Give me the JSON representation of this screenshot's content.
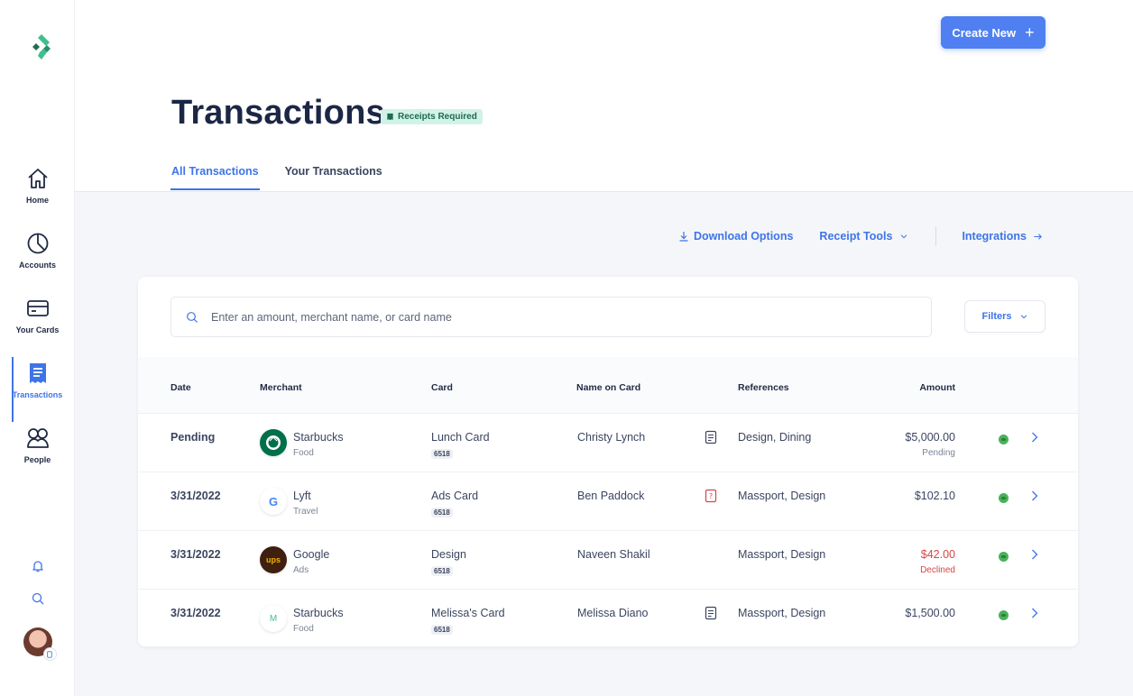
{
  "colors": {
    "accent": "#3f74e8",
    "primary_button": "#4f7ff0",
    "badge_bg": "#d3f2e7",
    "declined": "#d64545",
    "status_ok": "#49b25a"
  },
  "sidebar": {
    "logo": "brand-logo",
    "items": [
      {
        "label": "Home",
        "icon": "home-icon",
        "active": false
      },
      {
        "label": "Accounts",
        "icon": "pie-chart-icon",
        "active": false
      },
      {
        "label": "Your Cards",
        "icon": "credit-card-icon",
        "active": false
      },
      {
        "label": "Transactions",
        "icon": "receipt-icon",
        "active": true
      },
      {
        "label": "People",
        "icon": "people-icon",
        "active": false
      }
    ],
    "bottom": [
      "bell-icon",
      "search-icon",
      "avatar"
    ]
  },
  "header": {
    "create_button": "Create New",
    "title": "Transactions",
    "badge": "Receipts Required",
    "tabs": [
      {
        "label": "All Transactions",
        "active": true
      },
      {
        "label": "Your Transactions",
        "active": false
      }
    ]
  },
  "toolbar": {
    "download": "Download Options",
    "receipt_tools": "Receipt Tools",
    "integrations": "Integrations"
  },
  "search": {
    "placeholder": "Enter an amount, merchant name, or card name",
    "value": ""
  },
  "filters": {
    "label": "Filters"
  },
  "table": {
    "columns": [
      "Date",
      "Merchant",
      "Card",
      "Name on Card",
      "References",
      "Amount"
    ],
    "rows": [
      {
        "date": "Pending",
        "merchant": "Starbucks",
        "category": "Food",
        "logo": "starbucks-logo",
        "card": "Lunch Card",
        "card_last4": "6518",
        "name": "Christy Lynch",
        "receipt": "receipt-attached",
        "refs": "Design, Dining",
        "amount": "$5,000.00",
        "amount_status": "Pending",
        "declined": false
      },
      {
        "date": "3/31/2022",
        "merchant": "Lyft",
        "category": "Travel",
        "logo": "google-logo",
        "logo_text": "G",
        "card": "Ads Card",
        "card_last4": "6518",
        "name": "Ben Paddock",
        "receipt": "receipt-missing",
        "refs": "Massport, Design",
        "amount": "$102.10",
        "amount_status": "",
        "declined": false
      },
      {
        "date": "3/31/2022",
        "merchant": "Google",
        "category": "Ads",
        "logo": "ups-logo",
        "logo_text": "ups",
        "card": "Design",
        "card_last4": "6518",
        "name": "Naveen Shakil",
        "receipt": "none",
        "refs": "Massport, Design",
        "amount": "$42.00",
        "amount_status": "Declined",
        "declined": true
      },
      {
        "date": "3/31/2022",
        "merchant": "Starbucks",
        "category": "Food",
        "logo": "monogram-logo",
        "logo_text": "M",
        "card": "Melissa's Card",
        "card_last4": "6518",
        "name": "Melissa Diano",
        "receipt": "receipt-attached",
        "refs": "Massport, Design",
        "amount": "$1,500.00",
        "amount_status": "",
        "declined": false
      }
    ]
  }
}
